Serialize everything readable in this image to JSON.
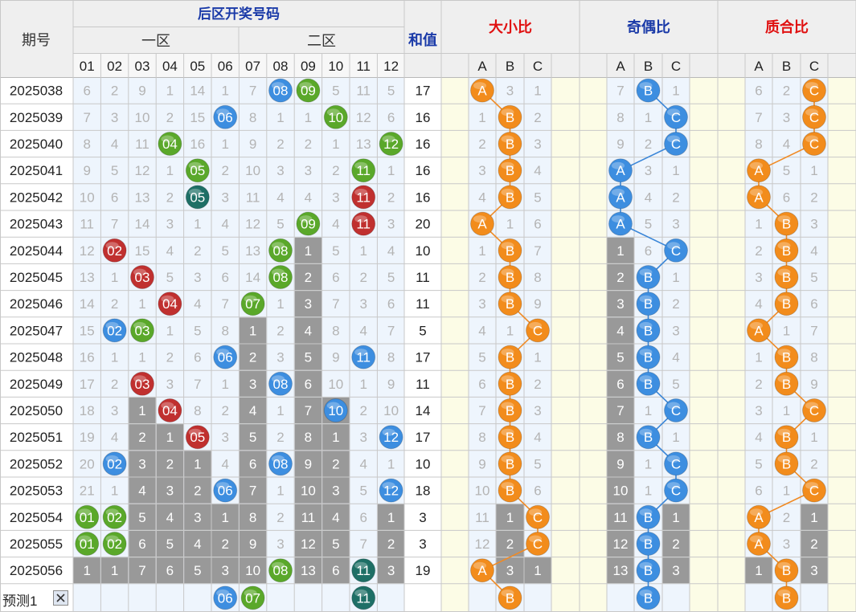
{
  "headers": {
    "issue": "期号",
    "back_area": "后区开奖号码",
    "zone1": "一区",
    "zone2": "二区",
    "sum": "和值",
    "size_ratio": "大小比",
    "odd_even_ratio": "奇偶比",
    "prime_composite_ratio": "质合比"
  },
  "numbers": [
    "01",
    "02",
    "03",
    "04",
    "05",
    "06",
    "07",
    "08",
    "09",
    "10",
    "11",
    "12"
  ],
  "abc": [
    "A",
    "B",
    "C"
  ],
  "colors": {
    "red": "#c0302f",
    "blue": "#3d8ee0",
    "green": "#5aa82a",
    "teal": "#1e6f66",
    "orange": "#f28c1c",
    "gray_cell": "#999999",
    "blue_line": "#3a86d8",
    "orange_line": "#f08a24"
  },
  "chart_data": {
    "type": "table",
    "rows": [
      {
        "issue": "2025038",
        "nums": [
          "6",
          "2",
          "9",
          "1",
          "14",
          "1",
          "7",
          "08",
          "09",
          "5",
          "11",
          "5"
        ],
        "sum": "17",
        "size": [
          "A",
          "3",
          "1"
        ],
        "oe": [
          "7",
          "B",
          "1"
        ],
        "pc": [
          "6",
          "2",
          "C"
        ]
      },
      {
        "issue": "2025039",
        "nums": [
          "7",
          "3",
          "10",
          "2",
          "15",
          "06",
          "8",
          "1",
          "1",
          "10",
          "12",
          "6"
        ],
        "sum": "16",
        "size": [
          "1",
          "B",
          "2"
        ],
        "oe": [
          "8",
          "1",
          "C"
        ],
        "pc": [
          "7",
          "3",
          "C"
        ]
      },
      {
        "issue": "2025040",
        "nums": [
          "8",
          "4",
          "11",
          "04",
          "16",
          "1",
          "9",
          "2",
          "2",
          "1",
          "13",
          "12"
        ],
        "sum": "16",
        "size": [
          "2",
          "B",
          "3"
        ],
        "oe": [
          "9",
          "2",
          "C"
        ],
        "pc": [
          "8",
          "4",
          "C"
        ]
      },
      {
        "issue": "2025041",
        "nums": [
          "9",
          "5",
          "12",
          "1",
          "05",
          "2",
          "10",
          "3",
          "3",
          "2",
          "11",
          "1"
        ],
        "sum": "16",
        "size": [
          "3",
          "B",
          "4"
        ],
        "oe": [
          "A",
          "3",
          "1"
        ],
        "pc": [
          "A",
          "5",
          "1"
        ]
      },
      {
        "issue": "2025042",
        "nums": [
          "10",
          "6",
          "13",
          "2",
          "05",
          "3",
          "11",
          "4",
          "4",
          "3",
          "11",
          "2"
        ],
        "sum": "16",
        "size": [
          "4",
          "B",
          "5"
        ],
        "oe": [
          "A",
          "4",
          "2"
        ],
        "pc": [
          "A",
          "6",
          "2"
        ]
      },
      {
        "issue": "2025043",
        "nums": [
          "11",
          "7",
          "14",
          "3",
          "1",
          "4",
          "12",
          "5",
          "09",
          "4",
          "11",
          "3"
        ],
        "sum": "20",
        "size": [
          "A",
          "1",
          "6"
        ],
        "oe": [
          "A",
          "5",
          "3"
        ],
        "pc": [
          "1",
          "B",
          "3"
        ]
      },
      {
        "issue": "2025044",
        "nums": [
          "12",
          "02",
          "15",
          "4",
          "2",
          "5",
          "13",
          "08",
          "1",
          "5",
          "1",
          "4"
        ],
        "sum": "10",
        "size": [
          "1",
          "B",
          "7"
        ],
        "oe": [
          "1",
          "6",
          "C"
        ],
        "pc": [
          "2",
          "B",
          "4"
        ]
      },
      {
        "issue": "2025045",
        "nums": [
          "13",
          "1",
          "03",
          "5",
          "3",
          "6",
          "14",
          "08",
          "2",
          "6",
          "2",
          "5"
        ],
        "sum": "11",
        "size": [
          "2",
          "B",
          "8"
        ],
        "oe": [
          "2",
          "B",
          "1"
        ],
        "pc": [
          "3",
          "B",
          "5"
        ]
      },
      {
        "issue": "2025046",
        "nums": [
          "14",
          "2",
          "1",
          "04",
          "4",
          "7",
          "07",
          "1",
          "3",
          "7",
          "3",
          "6"
        ],
        "sum": "11",
        "size": [
          "3",
          "B",
          "9"
        ],
        "oe": [
          "3",
          "B",
          "2"
        ],
        "pc": [
          "4",
          "B",
          "6"
        ]
      },
      {
        "issue": "2025047",
        "nums": [
          "15",
          "02",
          "03",
          "1",
          "5",
          "8",
          "1",
          "2",
          "4",
          "8",
          "4",
          "7"
        ],
        "sum": "5",
        "size": [
          "4",
          "1",
          "C"
        ],
        "oe": [
          "4",
          "B",
          "3"
        ],
        "pc": [
          "A",
          "1",
          "7"
        ]
      },
      {
        "issue": "2025048",
        "nums": [
          "16",
          "1",
          "1",
          "2",
          "6",
          "06",
          "2",
          "3",
          "5",
          "9",
          "11",
          "8"
        ],
        "sum": "17",
        "size": [
          "5",
          "B",
          "1"
        ],
        "oe": [
          "5",
          "B",
          "4"
        ],
        "pc": [
          "1",
          "B",
          "8"
        ]
      },
      {
        "issue": "2025049",
        "nums": [
          "17",
          "2",
          "03",
          "3",
          "7",
          "1",
          "3",
          "08",
          "6",
          "10",
          "1",
          "9"
        ],
        "sum": "11",
        "size": [
          "6",
          "B",
          "2"
        ],
        "oe": [
          "6",
          "B",
          "5"
        ],
        "pc": [
          "2",
          "B",
          "9"
        ]
      },
      {
        "issue": "2025050",
        "nums": [
          "18",
          "3",
          "1",
          "04",
          "8",
          "2",
          "4",
          "1",
          "7",
          "10",
          "2",
          "10"
        ],
        "sum": "14",
        "size": [
          "7",
          "B",
          "3"
        ],
        "oe": [
          "7",
          "1",
          "C"
        ],
        "pc": [
          "3",
          "1",
          "C"
        ]
      },
      {
        "issue": "2025051",
        "nums": [
          "19",
          "4",
          "2",
          "1",
          "05",
          "3",
          "5",
          "2",
          "8",
          "1",
          "3",
          "12"
        ],
        "sum": "17",
        "size": [
          "8",
          "B",
          "4"
        ],
        "oe": [
          "8",
          "B",
          "1"
        ],
        "pc": [
          "4",
          "B",
          "1"
        ]
      },
      {
        "issue": "2025052",
        "nums": [
          "20",
          "02",
          "3",
          "2",
          "1",
          "4",
          "6",
          "08",
          "9",
          "2",
          "4",
          "1"
        ],
        "sum": "10",
        "size": [
          "9",
          "B",
          "5"
        ],
        "oe": [
          "9",
          "1",
          "C"
        ],
        "pc": [
          "5",
          "B",
          "2"
        ]
      },
      {
        "issue": "2025053",
        "nums": [
          "21",
          "1",
          "4",
          "3",
          "2",
          "06",
          "7",
          "1",
          "10",
          "3",
          "5",
          "12"
        ],
        "sum": "18",
        "size": [
          "10",
          "B",
          "6"
        ],
        "oe": [
          "10",
          "1",
          "C"
        ],
        "pc": [
          "6",
          "1",
          "C"
        ]
      },
      {
        "issue": "2025054",
        "nums": [
          "01",
          "02",
          "5",
          "4",
          "3",
          "1",
          "8",
          "2",
          "11",
          "4",
          "6",
          "1"
        ],
        "sum": "3",
        "size": [
          "11",
          "1",
          "C"
        ],
        "oe": [
          "11",
          "B",
          "1"
        ],
        "pc": [
          "A",
          "2",
          "1"
        ]
      },
      {
        "issue": "2025055",
        "nums": [
          "01",
          "02",
          "6",
          "5",
          "4",
          "2",
          "9",
          "3",
          "12",
          "5",
          "7",
          "2"
        ],
        "sum": "3",
        "size": [
          "12",
          "2",
          "C"
        ],
        "oe": [
          "12",
          "B",
          "2"
        ],
        "pc": [
          "A",
          "3",
          "2"
        ]
      },
      {
        "issue": "2025056",
        "nums": [
          "1",
          "1",
          "7",
          "6",
          "5",
          "3",
          "10",
          "08",
          "13",
          "6",
          "11",
          "3"
        ],
        "sum": "19",
        "size": [
          "A",
          "3",
          "1"
        ],
        "oe": [
          "13",
          "B",
          "3"
        ],
        "pc": [
          "1",
          "B",
          "3"
        ]
      }
    ],
    "prediction": {
      "label": "预测1",
      "nums": [
        "",
        "",
        "",
        "",
        "",
        "06",
        "07",
        "",
        "",
        "",
        "11",
        ""
      ],
      "size": [
        "",
        "B",
        ""
      ],
      "oe": [
        "",
        "B",
        ""
      ],
      "pc": [
        "",
        "B",
        ""
      ]
    },
    "gray_cells": [
      [
        6,
        8
      ],
      [
        7,
        8
      ],
      [
        8,
        8
      ],
      [
        9,
        6
      ],
      [
        9,
        8
      ],
      [
        10,
        6
      ],
      [
        10,
        8
      ],
      [
        11,
        6
      ],
      [
        11,
        8
      ],
      [
        12,
        2
      ],
      [
        12,
        6
      ],
      [
        12,
        8
      ],
      [
        12,
        9
      ],
      [
        13,
        2
      ],
      [
        13,
        3
      ],
      [
        13,
        6
      ],
      [
        13,
        8
      ],
      [
        13,
        9
      ],
      [
        14,
        2
      ],
      [
        14,
        3
      ],
      [
        14,
        4
      ],
      [
        14,
        6
      ],
      [
        14,
        8
      ],
      [
        14,
        9
      ],
      [
        15,
        2
      ],
      [
        15,
        3
      ],
      [
        15,
        4
      ],
      [
        15,
        6
      ],
      [
        15,
        8
      ],
      [
        15,
        9
      ],
      [
        16,
        2
      ],
      [
        16,
        3
      ],
      [
        16,
        4
      ],
      [
        16,
        5
      ],
      [
        16,
        6
      ],
      [
        16,
        8
      ],
      [
        16,
        9
      ],
      [
        16,
        11
      ],
      [
        17,
        2
      ],
      [
        17,
        3
      ],
      [
        17,
        4
      ],
      [
        17,
        5
      ],
      [
        17,
        6
      ],
      [
        17,
        8
      ],
      [
        17,
        9
      ],
      [
        17,
        11
      ],
      [
        18,
        0
      ],
      [
        18,
        1
      ],
      [
        18,
        2
      ],
      [
        18,
        3
      ],
      [
        18,
        4
      ],
      [
        18,
        5
      ],
      [
        18,
        6
      ],
      [
        18,
        8
      ],
      [
        18,
        9
      ],
      [
        18,
        11
      ]
    ],
    "gray_ratio_cells": {
      "size": [
        [
          16,
          1
        ],
        [
          17,
          1
        ],
        [
          18,
          1
        ],
        [
          18,
          2
        ]
      ],
      "oe": [
        [
          6,
          0
        ],
        [
          7,
          0
        ],
        [
          8,
          0
        ],
        [
          9,
          0
        ],
        [
          10,
          0
        ],
        [
          11,
          0
        ],
        [
          12,
          0
        ],
        [
          13,
          0
        ],
        [
          14,
          0
        ],
        [
          15,
          0
        ],
        [
          16,
          0
        ],
        [
          16,
          2
        ],
        [
          17,
          0
        ],
        [
          17,
          2
        ],
        [
          18,
          0
        ],
        [
          18,
          2
        ]
      ],
      "pc": [
        [
          16,
          2
        ],
        [
          17,
          2
        ],
        [
          18,
          0
        ],
        [
          18,
          2
        ]
      ]
    },
    "ball_colors": {
      "0-7": "blue",
      "0-8": "green",
      "1-5": "blue",
      "1-9": "green",
      "2-3": "green",
      "2-11": "green",
      "3-4": "green",
      "3-10": "green",
      "4-4": "teal",
      "4-10": "red",
      "5-8": "green",
      "5-10": "red",
      "6-1": "red",
      "6-7": "green",
      "7-2": "red",
      "7-7": "green",
      "8-3": "red",
      "8-6": "green",
      "9-1": "blue",
      "9-2": "green",
      "10-5": "blue",
      "10-10": "blue",
      "11-2": "red",
      "11-7": "blue",
      "12-3": "red",
      "12-9": "blue",
      "13-4": "red",
      "13-11": "blue",
      "14-1": "blue",
      "14-7": "blue",
      "15-5": "blue",
      "15-11": "blue",
      "16-0": "green",
      "16-1": "green",
      "17-0": "green",
      "17-1": "green",
      "18-7": "green",
      "18-10": "teal",
      "19-5": "blue",
      "19-6": "green",
      "19-10": "teal"
    }
  }
}
